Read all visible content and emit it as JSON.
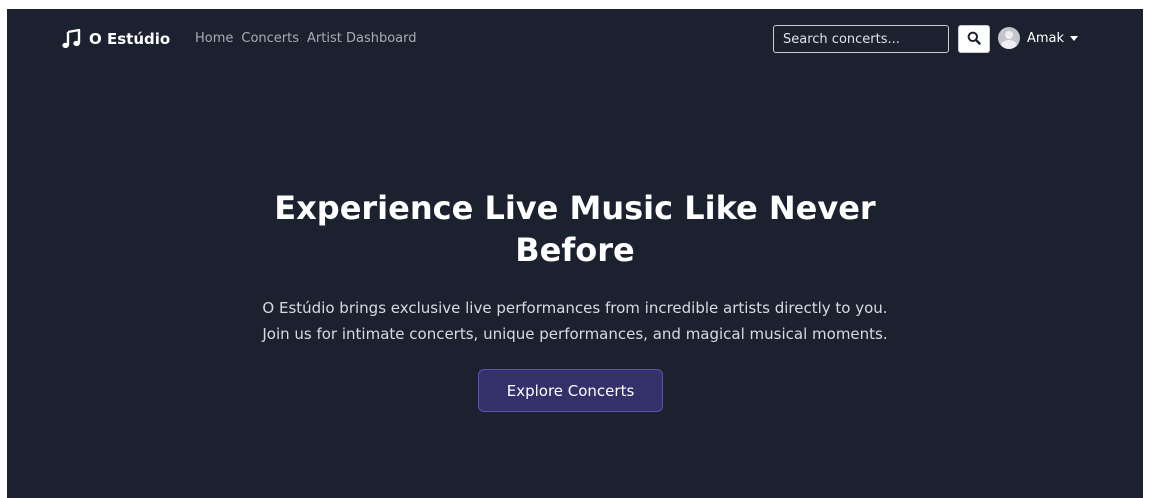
{
  "navbar": {
    "brand": "O Estúdio",
    "brand_icon": "music-note-icon",
    "links": [
      {
        "label": "Home"
      },
      {
        "label": "Concerts"
      },
      {
        "label": "Artist Dashboard"
      }
    ],
    "search": {
      "placeholder": "Search concerts...",
      "value": "",
      "button_icon": "search-icon"
    },
    "user": {
      "name": "Amak",
      "avatar_icon": "user-avatar-icon",
      "caret_icon": "caret-down-icon"
    }
  },
  "hero": {
    "title_lines": [
      "Experience Live Music Like Never",
      "Before"
    ],
    "subtitle_lines": [
      "O Estúdio brings exclusive live performances from incredible artists directly to you.",
      "Join us for intimate concerts, unique performances, and magical musical moments."
    ],
    "cta_label": "Explore Concerts"
  },
  "colors": {
    "background": "#1c2130",
    "text": "#ffffff",
    "nav_link": "#a8acb6",
    "cta_background": "#33306a",
    "cta_border": "#5a52b3"
  }
}
